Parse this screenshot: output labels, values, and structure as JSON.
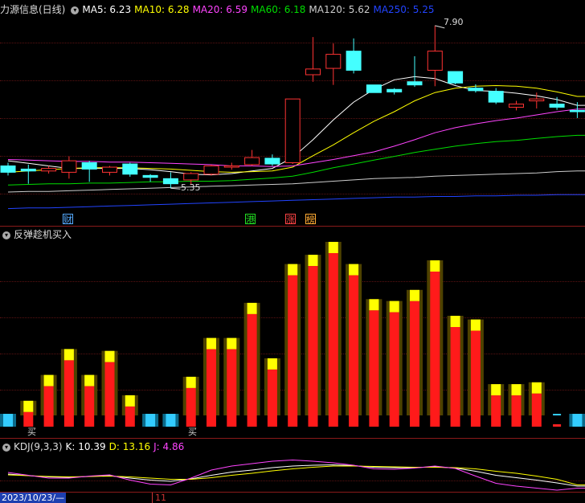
{
  "main_header": {
    "title": "力源信息(日线)",
    "ma5": "MA5: 6.23",
    "ma10": "MA10: 6.28",
    "ma20": "MA20: 6.59",
    "ma60": "MA60: 6.18",
    "ma120": "MA120: 5.62",
    "ma250": "MA250: 5.25"
  },
  "colors": {
    "ma5": "#ffffff",
    "ma10": "#ffff00",
    "ma20": "#ff44ff",
    "ma60": "#00dd00",
    "ma120": "#cccccc",
    "ma250": "#2244ff",
    "up": "#ff3333",
    "down": "#44ffff"
  },
  "annotations": {
    "high": "7.90",
    "low": "5.35"
  },
  "event_markers": [
    {
      "label": "财",
      "color": "#55aaff"
    },
    {
      "label": "港",
      "color": "#22dd22"
    },
    {
      "label": "涨",
      "color": "#ff4444"
    },
    {
      "label": "榜",
      "color": "#ffaa33"
    }
  ],
  "indicator_header": {
    "title": "反弹趁机买入"
  },
  "buy_labels": [
    "买",
    "买"
  ],
  "kdj_header": {
    "title": "KDJ(9,3,3)",
    "k": "K: 10.39",
    "d": "D: 13.16",
    "j": "J: 4.86"
  },
  "footer": {
    "date": "2023/10/23/—",
    "month": "11"
  },
  "chart_data": [
    {
      "type": "candlestick",
      "title": "力源信息(日线)",
      "candles": [
        {
          "o": 5.7,
          "h": 5.75,
          "l": 5.55,
          "c": 5.6
        },
        {
          "o": 5.65,
          "h": 5.72,
          "l": 5.42,
          "c": 5.62
        },
        {
          "o": 5.62,
          "h": 5.7,
          "l": 5.58,
          "c": 5.66
        },
        {
          "o": 5.6,
          "h": 5.85,
          "l": 5.5,
          "c": 5.78
        },
        {
          "o": 5.75,
          "h": 5.78,
          "l": 5.45,
          "c": 5.65
        },
        {
          "o": 5.6,
          "h": 5.7,
          "l": 5.55,
          "c": 5.68
        },
        {
          "o": 5.73,
          "h": 5.75,
          "l": 5.53,
          "c": 5.57
        },
        {
          "o": 5.55,
          "h": 5.57,
          "l": 5.45,
          "c": 5.52
        },
        {
          "o": 5.5,
          "h": 5.6,
          "l": 5.35,
          "c": 5.42
        },
        {
          "o": 5.48,
          "h": 5.6,
          "l": 5.4,
          "c": 5.58
        },
        {
          "o": 5.57,
          "h": 5.72,
          "l": 5.55,
          "c": 5.7
        },
        {
          "o": 5.68,
          "h": 5.75,
          "l": 5.64,
          "c": 5.7
        },
        {
          "o": 5.72,
          "h": 5.95,
          "l": 5.7,
          "c": 5.83
        },
        {
          "o": 5.82,
          "h": 5.88,
          "l": 5.7,
          "c": 5.73
        },
        {
          "o": 5.75,
          "h": 6.75,
          "l": 5.73,
          "c": 6.75
        },
        {
          "o": 7.13,
          "h": 7.72,
          "l": 7.02,
          "c": 7.22
        },
        {
          "o": 7.23,
          "h": 7.62,
          "l": 6.97,
          "c": 7.45
        },
        {
          "o": 7.5,
          "h": 7.7,
          "l": 7.15,
          "c": 7.2
        },
        {
          "o": 6.97,
          "h": 6.97,
          "l": 6.85,
          "c": 6.85
        },
        {
          "o": 6.9,
          "h": 6.92,
          "l": 6.82,
          "c": 6.86
        },
        {
          "o": 7.02,
          "h": 7.42,
          "l": 6.94,
          "c": 6.97
        },
        {
          "o": 7.2,
          "h": 7.9,
          "l": 6.95,
          "c": 7.5
        },
        {
          "o": 7.18,
          "h": 7.18,
          "l": 6.98,
          "c": 7.0
        },
        {
          "o": 6.92,
          "h": 6.98,
          "l": 6.85,
          "c": 6.88
        },
        {
          "o": 6.87,
          "h": 6.92,
          "l": 6.67,
          "c": 6.7
        },
        {
          "o": 6.62,
          "h": 6.72,
          "l": 6.57,
          "c": 6.67
        },
        {
          "o": 6.72,
          "h": 6.85,
          "l": 6.6,
          "c": 6.75
        },
        {
          "o": 6.67,
          "h": 6.78,
          "l": 6.58,
          "c": 6.62
        },
        {
          "o": 6.57,
          "h": 6.7,
          "l": 6.45,
          "c": 6.55
        }
      ],
      "ma_lines": [
        {
          "name": "MA5",
          "values": [
            5.78,
            5.74,
            5.7,
            5.66,
            5.66,
            5.66,
            5.66,
            5.64,
            5.61,
            5.57,
            5.56,
            5.58,
            5.62,
            5.66,
            5.83,
            6.11,
            6.42,
            6.7,
            6.9,
            7.05,
            7.1,
            7.07,
            6.96,
            6.88,
            6.87,
            6.84,
            6.8,
            6.74,
            6.65
          ]
        },
        {
          "name": "MA10",
          "values": [
            5.6,
            5.62,
            5.64,
            5.66,
            5.67,
            5.67,
            5.67,
            5.66,
            5.65,
            5.63,
            5.61,
            5.6,
            5.61,
            5.62,
            5.68,
            5.86,
            6.03,
            6.22,
            6.4,
            6.55,
            6.72,
            6.85,
            6.92,
            6.95,
            6.96,
            6.95,
            6.92,
            6.86,
            6.79
          ]
        },
        {
          "name": "MA20",
          "values": [
            5.8,
            5.79,
            5.78,
            5.77,
            5.77,
            5.76,
            5.76,
            5.75,
            5.74,
            5.73,
            5.72,
            5.7,
            5.7,
            5.69,
            5.7,
            5.75,
            5.8,
            5.86,
            5.92,
            6.01,
            6.11,
            6.22,
            6.3,
            6.36,
            6.41,
            6.45,
            6.5,
            6.55,
            6.59
          ]
        },
        {
          "name": "MA60",
          "values": [
            5.4,
            5.41,
            5.42,
            5.42,
            5.43,
            5.43,
            5.44,
            5.45,
            5.45,
            5.46,
            5.46,
            5.47,
            5.49,
            5.51,
            5.54,
            5.6,
            5.67,
            5.73,
            5.79,
            5.85,
            5.91,
            5.96,
            6.01,
            6.05,
            6.08,
            6.1,
            6.13,
            6.16,
            6.18
          ]
        },
        {
          "name": "MA120",
          "values": [
            5.29,
            5.3,
            5.3,
            5.31,
            5.32,
            5.33,
            5.34,
            5.35,
            5.36,
            5.37,
            5.38,
            5.39,
            5.4,
            5.41,
            5.42,
            5.44,
            5.46,
            5.48,
            5.5,
            5.51,
            5.52,
            5.54,
            5.55,
            5.56,
            5.57,
            5.58,
            5.59,
            5.61,
            5.62
          ]
        },
        {
          "name": "MA250",
          "values": [
            5.03,
            5.04,
            5.04,
            5.05,
            5.06,
            5.07,
            5.08,
            5.09,
            5.1,
            5.11,
            5.12,
            5.13,
            5.14,
            5.15,
            5.16,
            5.17,
            5.18,
            5.19,
            5.2,
            5.21,
            5.21,
            5.22,
            5.22,
            5.23,
            5.23,
            5.24,
            5.24,
            5.25,
            5.25
          ]
        }
      ],
      "ylim": [
        5.0,
        8.05
      ]
    },
    {
      "type": "bar",
      "title": "反弹趁机买入",
      "bars": [
        {
          "kind": "cyan",
          "v": 7
        },
        {
          "kind": "red",
          "v": 14
        },
        {
          "kind": "red",
          "v": 28
        },
        {
          "kind": "red",
          "v": 42
        },
        {
          "kind": "red",
          "v": 28
        },
        {
          "kind": "red",
          "v": 41
        },
        {
          "kind": "red",
          "v": 17
        },
        {
          "kind": "cyan",
          "v": 1
        },
        {
          "kind": "cyan",
          "v": 7
        },
        {
          "kind": "red",
          "v": 27
        },
        {
          "kind": "red",
          "v": 48
        },
        {
          "kind": "red",
          "v": 48
        },
        {
          "kind": "red",
          "v": 67
        },
        {
          "kind": "red",
          "v": 37
        },
        {
          "kind": "red",
          "v": 88
        },
        {
          "kind": "red",
          "v": 93
        },
        {
          "kind": "red",
          "v": 100
        },
        {
          "kind": "red",
          "v": 88
        },
        {
          "kind": "red",
          "v": 69
        },
        {
          "kind": "red",
          "v": 68
        },
        {
          "kind": "red",
          "v": 74
        },
        {
          "kind": "red",
          "v": 90
        },
        {
          "kind": "red",
          "v": 60
        },
        {
          "kind": "red",
          "v": 58
        },
        {
          "kind": "red",
          "v": 23
        },
        {
          "kind": "red",
          "v": 23
        },
        {
          "kind": "red",
          "v": 24
        },
        {
          "kind": "red_small",
          "v": 1
        },
        {
          "kind": "cyan",
          "v": 7
        }
      ],
      "ylim": [
        0,
        100
      ]
    },
    {
      "type": "line",
      "title": "KDJ(9,3,3)",
      "series": [
        {
          "name": "K",
          "values": [
            40,
            36,
            33,
            32,
            34,
            36,
            30,
            25,
            22,
            28,
            37,
            45,
            50,
            56,
            60,
            62,
            63,
            61,
            57,
            56,
            56,
            58,
            55,
            47,
            37,
            31,
            25,
            18,
            10
          ]
        },
        {
          "name": "D",
          "values": [
            38,
            36,
            34,
            33,
            34,
            35,
            33,
            30,
            27,
            27,
            31,
            37,
            42,
            48,
            53,
            57,
            60,
            60,
            59,
            58,
            57,
            57,
            56,
            53,
            47,
            42,
            35,
            27,
            13
          ]
        },
        {
          "name": "J",
          "values": [
            44,
            37,
            30,
            30,
            35,
            38,
            25,
            15,
            13,
            30,
            50,
            60,
            66,
            72,
            75,
            72,
            68,
            62,
            53,
            52,
            55,
            60,
            54,
            35,
            17,
            10,
            5,
            0,
            5
          ]
        }
      ],
      "ylim": [
        0,
        100
      ]
    }
  ]
}
